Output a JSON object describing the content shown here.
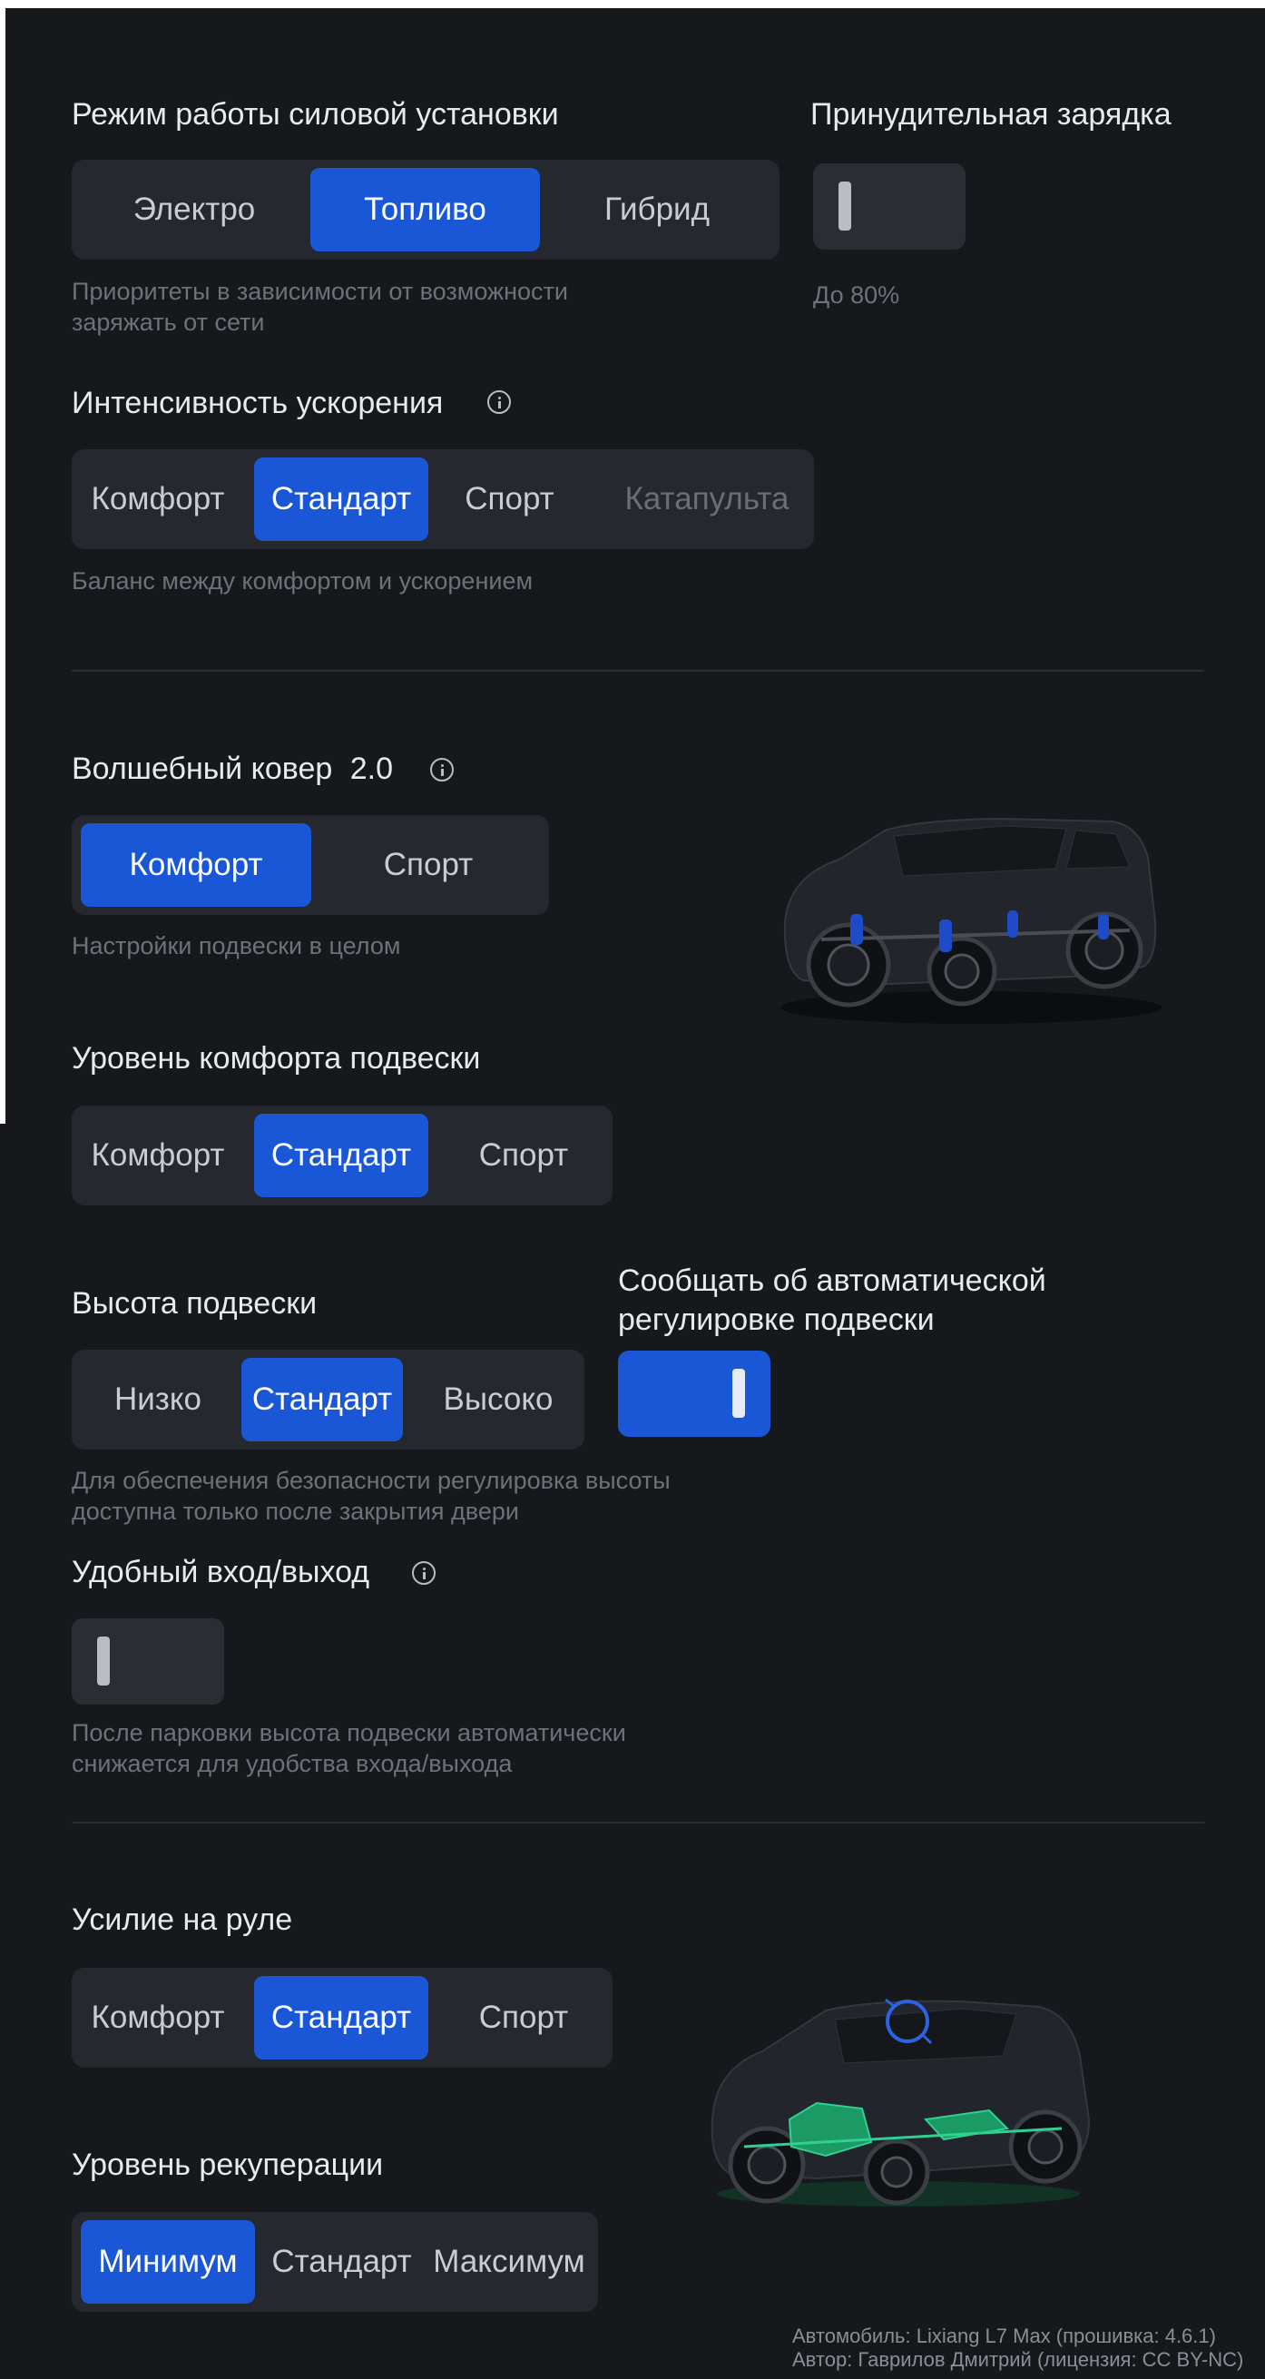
{
  "powertrain": {
    "title": "Режим работы силовой установки",
    "options": [
      "Электро",
      "Топливо",
      "Гибрид"
    ],
    "selected": "Топливо",
    "description": "Приоритеты в зависимости от возможности заряжать от сети"
  },
  "forced_charge": {
    "title": "Принудительная зарядка",
    "enabled": false,
    "note": "До 80%"
  },
  "acceleration": {
    "title": "Интенсивность ускорения",
    "icon": "info-icon",
    "options": [
      "Комфорт",
      "Стандарт",
      "Спорт",
      "Катапульта"
    ],
    "selected": "Стандарт",
    "disabled": [
      "Катапульта"
    ],
    "description": "Баланс между комфортом и ускорением"
  },
  "magic_carpet": {
    "title": "Волшебный ковер",
    "version": "2.0",
    "icon": "info-icon",
    "options": [
      "Комфорт",
      "Спорт"
    ],
    "selected": "Комфорт",
    "description": "Настройки подвески в целом"
  },
  "suspension_comfort": {
    "title": "Уровень комфорта подвески",
    "options": [
      "Комфорт",
      "Стандарт",
      "Спорт"
    ],
    "selected": "Стандарт"
  },
  "suspension_height": {
    "title": "Высота подвески",
    "options": [
      "Низко",
      "Стандарт",
      "Высоко"
    ],
    "selected": "Стандарт",
    "description": "Для обеспечения безопасности регулировка высоты доступна только после закрытия двери"
  },
  "auto_adjust_notify": {
    "title": "Сообщать об автоматической регулировке подвески",
    "enabled": true
  },
  "easy_entry": {
    "title": "Удобный вход/выход",
    "icon": "info-icon",
    "enabled": false,
    "description": "После парковки высота подвески автоматически снижается для удобства входа/выхода"
  },
  "steering": {
    "title": "Усилие на руле",
    "options": [
      "Комфорт",
      "Стандарт",
      "Спорт"
    ],
    "selected": "Стандарт"
  },
  "regen": {
    "title": "Уровень рекуперации",
    "options": [
      "Минимум",
      "Стандарт",
      "Максимум"
    ],
    "selected": "Минимум"
  },
  "footer": {
    "line1": "Автомобиль: Lixiang L7 Max (прошивка: 4.6.1)",
    "line2": "Автор: Гаврилов Дмитрий (лицензия: CC BY-NC)"
  },
  "colors": {
    "background": "#16181c",
    "accent": "#1a57d6",
    "panel": "#25282e"
  }
}
